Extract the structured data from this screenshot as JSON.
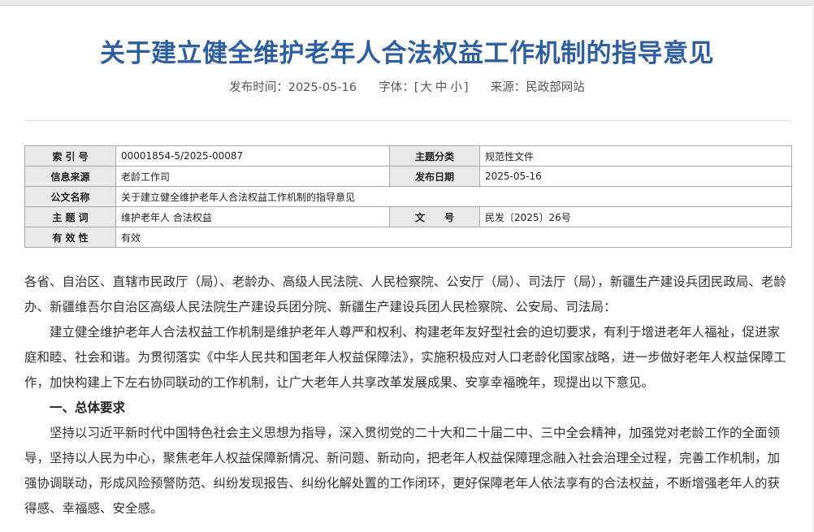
{
  "title": "关于建立健全维护老年人合法权益工作机制的指导意见",
  "meta": {
    "publish_label": "发布时间：",
    "publish_date": "2025-05-16",
    "font_label": "字体：",
    "font_open": "[",
    "font_large": "大",
    "font_medium": "中",
    "font_small": "小",
    "font_close": "]",
    "source_label": "来源：",
    "source": "民政部网站"
  },
  "info_table": {
    "index_label": "索 引 号",
    "index_value": "00001854-5/2025-00087",
    "category_label": "主题分类",
    "category_value": "规范性文件",
    "origin_label": "信息来源",
    "origin_value": "老龄工作司",
    "date_label": "发布日期",
    "date_value": "2025-05-16",
    "doc_name_label": "公文名称",
    "doc_name_value": "关于建立健全维护老年人合法权益工作机制的指导意见",
    "keywords_label": "主 题 词",
    "keywords_value": "维护老年人 合法权益",
    "doc_no_label": "文　　号",
    "doc_no_value": "民发〔2025〕26号",
    "validity_label": "有 效 性",
    "validity_value": "有效"
  },
  "body": {
    "addressees": "各省、自治区、直辖市民政厅（局）、老龄办、高级人民法院、人民检察院、公安厅（局）、司法厅（局），新疆生产建设兵团民政局、老龄办、新疆维吾尔自治区高级人民法院生产建设兵团分院、新疆生产建设兵团人民检察院、公安局、司法局：",
    "intro": "建立健全维护老年人合法权益工作机制是维护老年人尊严和权利、构建老年友好型社会的迫切要求，有利于增进老年人福祉，促进家庭和睦、社会和谐。为贯彻落实《中华人民共和国老年人权益保障法》，实施积极应对人口老龄化国家战略，进一步做好老年人权益保障工作，加快构建上下左右协同联动的工作机制，让广大老年人共享改革发展成果、安享幸福晚年，现提出以下意见。",
    "heading1": "一、总体要求",
    "para1": "坚持以习近平新时代中国特色社会主义思想为指导，深入贯彻党的二十大和二十届二中、三中全会精神，加强党对老龄工作的全面领导，坚持以人民为中心，聚焦老年人权益保障新情况、新问题、新动向，把老年人权益保障理念融入社会治理全过程，完善工作机制，加强协调联动，形成风险预警防范、纠纷发现报告、纠纷化解处置的工作闭环，更好保障老年人依法享有的合法权益，不断增强老年人的获得感、幸福感、安全感。"
  }
}
